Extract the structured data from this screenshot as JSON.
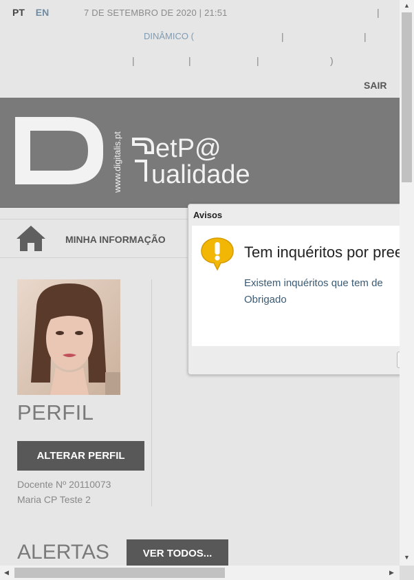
{
  "topbar": {
    "lang_pt": "PT",
    "lang_en": "EN",
    "datetime": "7 DE SETEMBRO DE 2020 | 21:51",
    "separator": "|",
    "dinamico": "DINÂMICO (",
    "close_paren": ")",
    "logout": "SAIR"
  },
  "banner": {
    "logo_side_text": "www.digitalis.pt",
    "app_name_line1": "etP@",
    "app_name_line2": "ualidade"
  },
  "nav": {
    "home_icon": "home-icon",
    "my_info": "MINHA INFORMAÇÃO"
  },
  "profile": {
    "heading": "PERFIL",
    "change_button": "ALTERAR PERFIL",
    "docente": "Docente Nº 20110073",
    "name": "Maria CP Teste 2"
  },
  "alerts": {
    "heading": "ALERTAS",
    "view_all": "VER TODOS..."
  },
  "dialog": {
    "title": "Avisos",
    "icon": "warning-icon",
    "heading": "Tem inquéritos por pree",
    "line1": "Existem inquéritos que tem de",
    "line2": "Obrigado"
  },
  "colors": {
    "banner": "#7a7a7a",
    "button": "#585858",
    "link_blue": "#6f8ba3",
    "warning_yellow": "#f2b705"
  }
}
